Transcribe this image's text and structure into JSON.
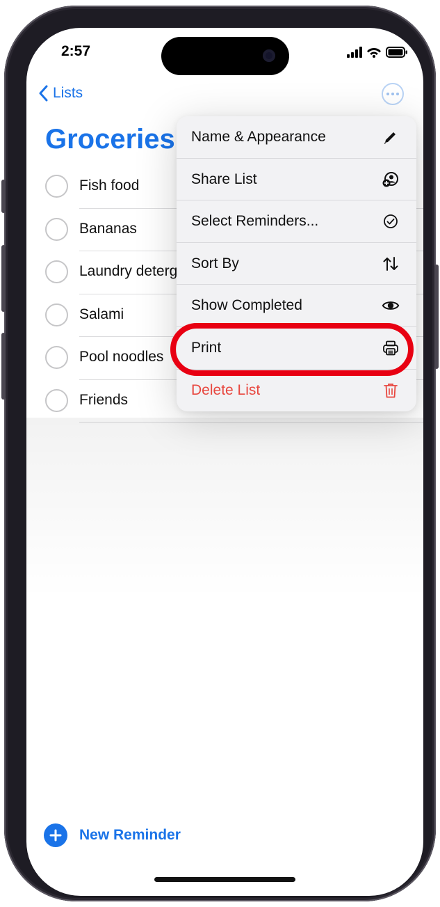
{
  "status_bar": {
    "time": "2:57"
  },
  "nav": {
    "back_label": "Lists",
    "more_icon": "ellipsis-circle-icon"
  },
  "list": {
    "title": "Groceries",
    "items": [
      {
        "title": "Fish food"
      },
      {
        "title": "Bananas"
      },
      {
        "title": "Laundry detergent"
      },
      {
        "title": "Salami"
      },
      {
        "title": "Pool noodles"
      },
      {
        "title": "Friends"
      }
    ]
  },
  "menu": {
    "items": [
      {
        "label": "Name & Appearance",
        "icon": "pencil-icon"
      },
      {
        "label": "Share List",
        "icon": "share-person-icon"
      },
      {
        "label": "Select Reminders...",
        "icon": "checkmark-circle-icon"
      },
      {
        "label": "Sort By",
        "icon": "sort-arrows-icon"
      },
      {
        "label": "Show Completed",
        "icon": "eye-icon"
      },
      {
        "label": "Print",
        "icon": "printer-icon"
      },
      {
        "label": "Delete List",
        "icon": "trash-icon"
      }
    ]
  },
  "footer": {
    "new_reminder_label": "New Reminder"
  },
  "colors": {
    "accent": "#1a73e8",
    "danger": "#e8473f",
    "highlight": "#e80012"
  }
}
